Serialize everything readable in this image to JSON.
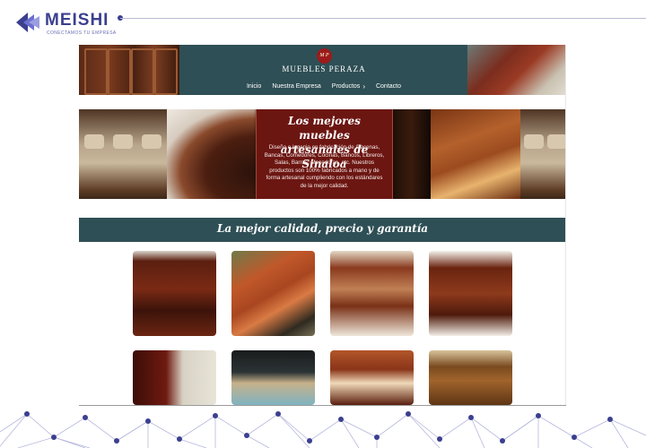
{
  "slide": {
    "brand_name": "MEISHI",
    "brand_tagline": "CONECTAMOS TU EMPRESA",
    "accent_color": "#3b3f8f",
    "decoration": "network-nodes-icon"
  },
  "site": {
    "logo_text": "M P",
    "title": "MUEBLES PERAZA",
    "nav": [
      {
        "label": "Inicio"
      },
      {
        "label": "Nuestra Empresa"
      },
      {
        "label": "Productos",
        "icon": "chevron-right-icon"
      },
      {
        "label": "Contacto"
      }
    ],
    "hero": {
      "title": "Los mejores muebles artesanales de Sinaloa",
      "text": "Diseño e ingenio en fabricación de Alacenas, Bancas, Comedores, Cocinas, Bancos, Libreros, Salas, Barras, Mecedoras, etc. Nuestros productos son 100% fabricados a mano y de forma artesanal cumpliendo con los estándares de la mejor calidad."
    },
    "section_title": "La mejor calidad, precio y garantía",
    "colors": {
      "header_bg": "#2e4f55",
      "caption_bg": "#6c1612"
    },
    "products": [
      {
        "name": "hutch-cabinet"
      },
      {
        "name": "garden-bench"
      },
      {
        "name": "dining-chairs"
      },
      {
        "name": "wine-bar-table"
      },
      {
        "name": "display-cabinet"
      },
      {
        "name": "modern-kitchen"
      },
      {
        "name": "dining-room"
      },
      {
        "name": "library-shelves"
      }
    ]
  }
}
